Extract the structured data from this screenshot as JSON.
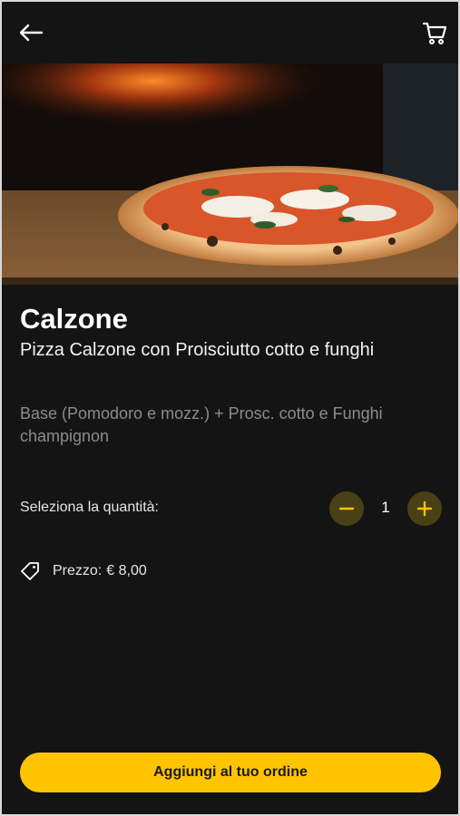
{
  "product": {
    "name": "Calzone",
    "subtitle": "Pizza Calzone con Proisciutto cotto e funghi",
    "ingredients": "Base (Pomodoro e mozz.) + Prosc. cotto e Funghi champignon"
  },
  "quantity": {
    "label": "Seleziona la quantità:",
    "value": "1"
  },
  "price": {
    "label": "Prezzo:",
    "value": "€ 8,00"
  },
  "actions": {
    "add_to_order": "Aggiungi al tuo ordine"
  },
  "icons": {
    "back": "arrow-left-icon",
    "cart": "cart-icon",
    "minus": "minus-icon",
    "plus": "plus-icon",
    "price_tag": "tag-icon"
  },
  "colors": {
    "background": "#141414",
    "accent": "#ffc400",
    "stepper_bg": "#4a4015"
  }
}
